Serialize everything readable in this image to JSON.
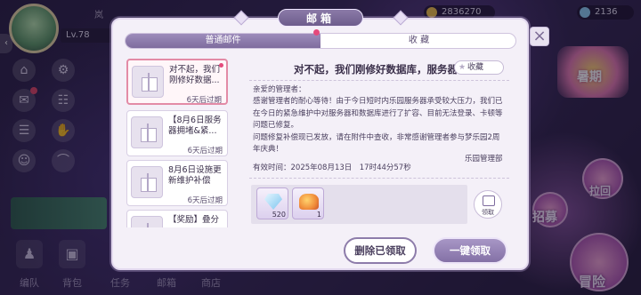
{
  "hud": {
    "level": "Lv.78",
    "player_name": "岚",
    "gold": "2836270",
    "gems": "2136"
  },
  "event_banner": "暑期",
  "right_menu": {
    "top": "拉回",
    "middle": "招募",
    "bottom": "冒险"
  },
  "bottom_nav": [
    "编队",
    "背包",
    "任务",
    "邮箱",
    "商店"
  ],
  "dialog": {
    "title": "邮箱",
    "tabs": [
      {
        "label": "普通邮件",
        "active": true
      },
      {
        "label": "收 藏",
        "active": false
      }
    ],
    "mails": [
      {
        "subject": "对不起，我们刚修好数据...",
        "expiry": "6天后过期",
        "selected": true,
        "unread": true
      },
      {
        "subject": "【8月6日服务器拥堵&紧...",
        "expiry": "6天后过期",
        "selected": false,
        "unread": false
      },
      {
        "subject": "8月6日设施更新维护补偿",
        "expiry": "6天后过期",
        "selected": false,
        "unread": false
      },
      {
        "subject": "【奖励】叠分",
        "expiry": "",
        "selected": false,
        "unread": false
      }
    ],
    "content": {
      "title": "对不起，我们刚修好数据库，服务器",
      "favorite_label": "收藏",
      "greeting": "亲爱的管理者：",
      "body1": "感谢管理者的耐心等待！由于今日短时内乐园服务器承受较大压力，我们已在今日的紧急维护中对服务器和数据库进行了扩容、目前无法登录、卡顿等问题已修复。",
      "body2": "问题修复补偿现已发放，请在附件中查收，非常感谢管理者参与梦乐园2周年庆典！",
      "sender": "乐园管理部",
      "validity": "有效时间：2025年08月13日　17时44分57秒",
      "attachments": [
        {
          "item": "diamond",
          "qty": "520"
        },
        {
          "item": "food",
          "qty": "1"
        }
      ],
      "claim_label": "领取"
    },
    "delete_claimed_label": "删除已领取",
    "claim_all_label": "一键领取"
  },
  "colors": {
    "accent": "#8471a6",
    "selected_border": "#e38ba6",
    "badge": "#e44a7c"
  }
}
